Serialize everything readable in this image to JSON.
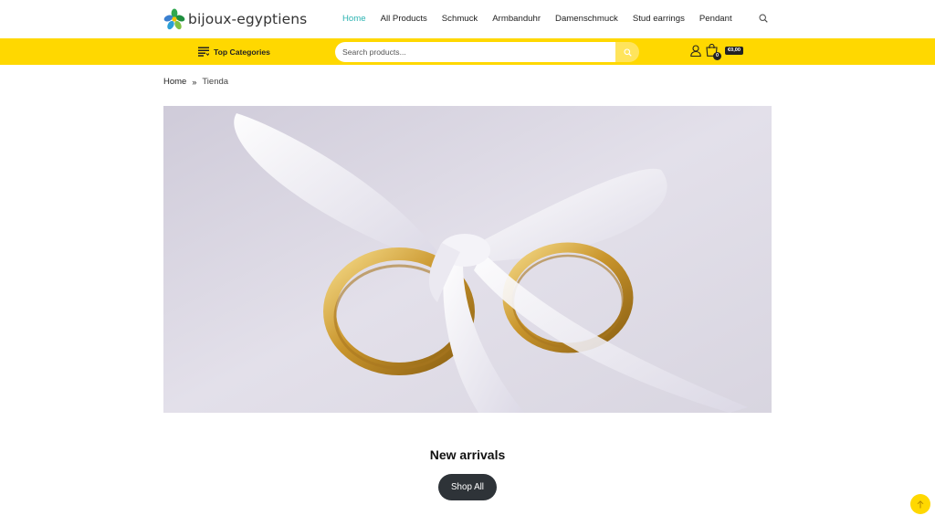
{
  "brand": {
    "name": "bijoux-egyptiens"
  },
  "nav": {
    "items": [
      {
        "label": "Home",
        "active": true
      },
      {
        "label": "All Products",
        "active": false
      },
      {
        "label": "Schmuck",
        "active": false
      },
      {
        "label": "Armbanduhr",
        "active": false
      },
      {
        "label": "Damenschmuck",
        "active": false
      },
      {
        "label": "Stud earrings",
        "active": false
      },
      {
        "label": "Pendant",
        "active": false
      }
    ],
    "search_icon": "search-icon"
  },
  "toolbar": {
    "categories_label": "Top Categories",
    "search_placeholder": "Search products...",
    "cart_count": "0",
    "cart_total": "€0,00"
  },
  "breadcrumb": {
    "home": "Home",
    "current": "Tienda"
  },
  "section": {
    "title": "New arrivals",
    "button_label": "Shop All"
  },
  "colors": {
    "accent": "#2bb3b1",
    "bar": "#ffd800",
    "dark": "#2e3338"
  }
}
